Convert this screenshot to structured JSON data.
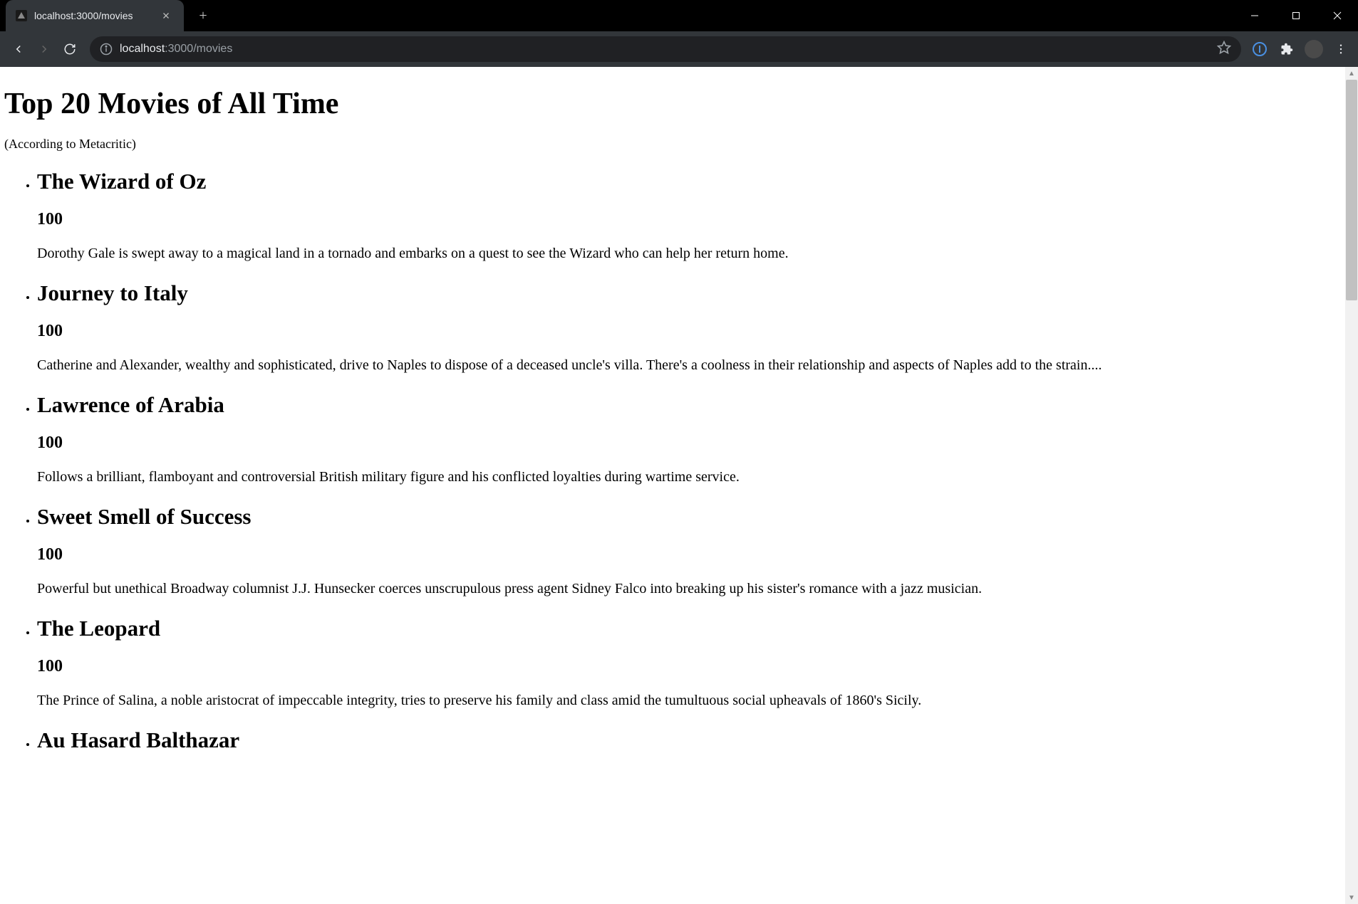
{
  "browser": {
    "tab_title": "localhost:3000/movies",
    "url_host": "localhost",
    "url_port_path": ":3000/movies"
  },
  "page": {
    "title": "Top 20 Movies of All Time",
    "subtitle": "(According to Metacritic)"
  },
  "movies": [
    {
      "title": "The Wizard of Oz",
      "score": "100",
      "description": "Dorothy Gale is swept away to a magical land in a tornado and embarks on a quest to see the Wizard who can help her return home."
    },
    {
      "title": "Journey to Italy",
      "score": "100",
      "description": "Catherine and Alexander, wealthy and sophisticated, drive to Naples to dispose of a deceased uncle's villa. There's a coolness in their relationship and aspects of Naples add to the strain...."
    },
    {
      "title": "Lawrence of Arabia",
      "score": "100",
      "description": "Follows a brilliant, flamboyant and controversial British military figure and his conflicted loyalties during wartime service."
    },
    {
      "title": "Sweet Smell of Success",
      "score": "100",
      "description": "Powerful but unethical Broadway columnist J.J. Hunsecker coerces unscrupulous press agent Sidney Falco into breaking up his sister's romance with a jazz musician."
    },
    {
      "title": "The Leopard",
      "score": "100",
      "description": "The Prince of Salina, a noble aristocrat of impeccable integrity, tries to preserve his family and class amid the tumultuous social upheavals of 1860's Sicily."
    },
    {
      "title": "Au Hasard Balthazar",
      "score": "",
      "description": ""
    }
  ]
}
